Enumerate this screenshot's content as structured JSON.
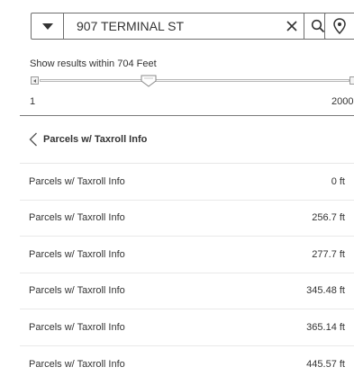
{
  "search": {
    "value": "907 TERMINAL ST",
    "dropdown_icon": "caret-down-icon",
    "clear_icon": "close-icon",
    "search_icon": "search-icon",
    "locate_icon": "location-pin-icon"
  },
  "distance": {
    "label": "Show results within 704 Feet",
    "min": "1",
    "max": "2000",
    "value": 704
  },
  "list": {
    "header": "Parcels w/ Taxroll Info",
    "rows": [
      {
        "name": "Parcels w/ Taxroll Info",
        "dist": "0 ft"
      },
      {
        "name": "Parcels w/ Taxroll Info",
        "dist": "256.7 ft"
      },
      {
        "name": "Parcels w/ Taxroll Info",
        "dist": "277.7 ft"
      },
      {
        "name": "Parcels w/ Taxroll Info",
        "dist": "345.48 ft"
      },
      {
        "name": "Parcels w/ Taxroll Info",
        "dist": "365.14 ft"
      },
      {
        "name": "Parcels w/ Taxroll Info",
        "dist": "445.57 ft"
      }
    ]
  }
}
